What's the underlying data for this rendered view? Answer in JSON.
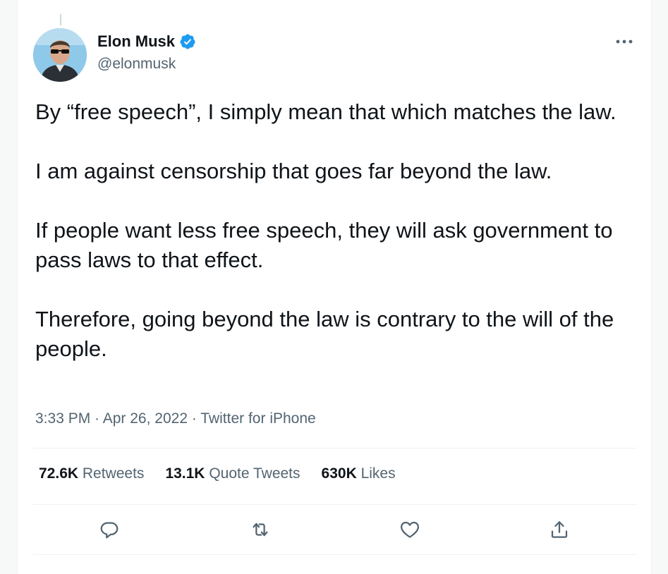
{
  "author": {
    "name": "Elon Musk",
    "handle": "@elonmusk",
    "verified": true
  },
  "tweet": {
    "paragraphs": [
      "By “free speech”, I simply mean that which matches the law.",
      "I am against censorship that goes far beyond the law.",
      "If people want less free speech, they will ask government to pass laws to that effect.",
      "Therefore, going beyond the law is contrary to the will of the people."
    ],
    "time": "3:33 PM",
    "date": "Apr 26, 2022",
    "source": "Twitter for iPhone",
    "separator": " · "
  },
  "stats": {
    "retweets": {
      "value": "72.6K",
      "label": "Retweets"
    },
    "quotes": {
      "value": "13.1K",
      "label": "Quote Tweets"
    },
    "likes": {
      "value": "630K",
      "label": "Likes"
    }
  },
  "actions": {
    "reply": "reply-icon",
    "retweet": "retweet-icon",
    "like": "heart-icon",
    "share": "share-icon"
  },
  "colors": {
    "text": "#0f1419",
    "secondary": "#536471",
    "verified": "#1d9bf0",
    "divider": "#eff3f4"
  }
}
